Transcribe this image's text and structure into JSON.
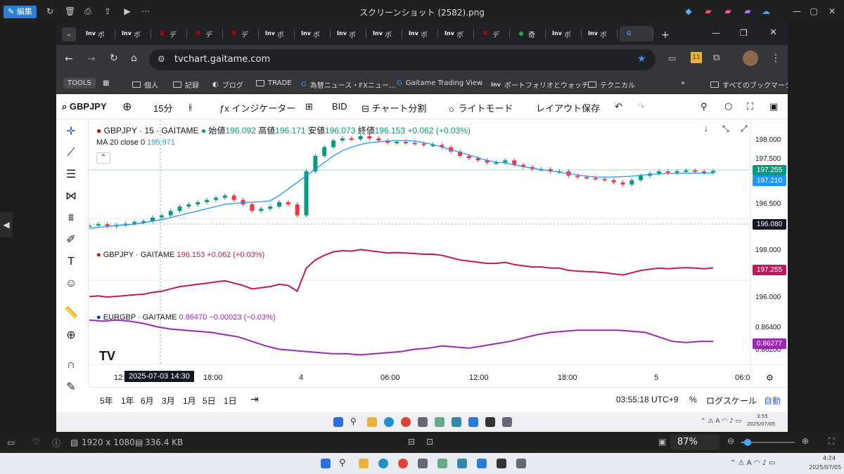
{
  "viewer": {
    "edit_label": "編集",
    "title": "スクリーンショット (2582).png",
    "dimensions": "1920 x 1080",
    "size": "336.4 KB",
    "zoom": "87%",
    "zoom_fraction": 0.12
  },
  "browser": {
    "url": "tvchart.gaitame.com",
    "tabs": [
      {
        "icon": "Inv",
        "label": "ボ",
        "color": "#ffffff"
      },
      {
        "icon": "Inv",
        "label": "ボ",
        "color": "#ffffff"
      },
      {
        "icon": "R",
        "label": "デ",
        "color": "#cc0000"
      },
      {
        "icon": "R",
        "label": "デ",
        "color": "#cc0000"
      },
      {
        "icon": "R",
        "label": "デ",
        "color": "#cc0000"
      },
      {
        "icon": "Inv",
        "label": "ボ",
        "color": "#ffffff"
      },
      {
        "icon": "Inv",
        "label": "ボ",
        "color": "#ffffff"
      },
      {
        "icon": "Inv",
        "label": "ボ",
        "color": "#ffffff"
      },
      {
        "icon": "Inv",
        "label": "ボ",
        "color": "#ffffff"
      },
      {
        "icon": "Inv",
        "label": "ボ",
        "color": "#ffffff"
      },
      {
        "icon": "Inv",
        "label": "ボ",
        "color": "#ffffff"
      },
      {
        "icon": "R",
        "label": "デ",
        "color": "#cc0000"
      },
      {
        "icon": "●",
        "label": "奇",
        "color": "#22aa44"
      },
      {
        "icon": "Inv",
        "label": "ボ",
        "color": "#ffffff"
      },
      {
        "icon": "Inv",
        "label": "ボ",
        "color": "#ffffff"
      },
      {
        "icon": "G",
        "label": "",
        "color": "#4a8af4"
      }
    ],
    "bookmarks": [
      "TOOLS",
      "個人",
      "記録",
      "ブログ",
      "TRADE",
      "為替ニュース・FXニュー…",
      "Gaitame Trading View",
      "ポートフォリオとウォッチ…",
      "テクニカル",
      "すべてのブックマーク"
    ]
  },
  "tv": {
    "toolbar": {
      "symbol": "GBPJPY",
      "interval": "15分",
      "indicators": "インジケーター",
      "bid": "BID",
      "split": "チャート分割",
      "theme": "ライトモード",
      "save": "レイアウト保存"
    },
    "main": {
      "title": "GBPJPY · 15 · GAITAME",
      "open_label": "始値",
      "open": "196.092",
      "high_label": "高値",
      "high": "196.171",
      "low_label": "安値",
      "low": "196.073",
      "close_label": "終値",
      "close": "196.153",
      "change": "+0.062 (+0.03%)",
      "ma_label": "MA 20 close 0",
      "ma_value": "195.971"
    },
    "pane2": {
      "title": "GBPJPY · GAITAME",
      "value": "196.153",
      "change": "+0.062 (+0.03%)"
    },
    "pane3": {
      "title": "EURGBP · GAITAME",
      "value": "0.86470",
      "change": "−0.00023 (−0.03%)"
    },
    "axis": {
      "p1": [
        "198.000",
        "197.500",
        "196.500"
      ],
      "p2": [
        "198.000",
        "196.000"
      ],
      "p3": [
        "0.86400",
        "0.86200"
      ]
    },
    "labels": {
      "last": "197.255",
      "ma": "197.210",
      "crosshair": "196.080",
      "pane2": "197.255",
      "pane3": "0.86277"
    },
    "time_axis": [
      "12:",
      "2025-07-03   14:30",
      "18:00",
      "4",
      "06:00",
      "12:00",
      "18:00",
      "5",
      "06:0"
    ],
    "bottom": {
      "ranges": [
        "5年",
        "1年",
        "6月",
        "3月",
        "1月",
        "5日",
        "1日"
      ],
      "clock": "03:55:18 UTC+9",
      "percent": "%",
      "log": "ログスケール",
      "auto": "自動"
    },
    "colors": {
      "up": "#089981",
      "down": "#f23645",
      "ma": "#2196f3",
      "pane2": "#c2185b",
      "pane3": "#9c27b0"
    }
  },
  "chart_data": [
    {
      "type": "line",
      "y": [
        196.02,
        196.05,
        196.0,
        196.03,
        196.06,
        196.1,
        196.12,
        196.2,
        196.25,
        196.35,
        196.45,
        196.5,
        196.55,
        196.6,
        196.65,
        196.7,
        196.6,
        196.5,
        196.35,
        196.4,
        196.45,
        196.55,
        196.5,
        196.25,
        197.25,
        197.6,
        197.8,
        197.95,
        198.0,
        197.98,
        198.05,
        198.0,
        197.95,
        197.9,
        197.92,
        197.9,
        197.88,
        197.85,
        197.85,
        197.8,
        197.7,
        197.6,
        197.55,
        197.5,
        197.45,
        197.45,
        197.5,
        197.4,
        197.35,
        197.3,
        197.3,
        197.25,
        197.25,
        197.15,
        197.12,
        197.1,
        197.08,
        197.05,
        197.0,
        196.95,
        197.05,
        197.15,
        197.2,
        197.25,
        197.22,
        197.25,
        197.27,
        197.25,
        197.22,
        197.26
      ],
      "ma20": [
        195.95,
        195.98,
        196.0,
        196.02,
        196.03,
        196.05,
        196.08,
        196.12,
        196.15,
        196.2,
        196.25,
        196.3,
        196.35,
        196.4,
        196.45,
        196.5,
        196.52,
        196.54,
        196.55,
        196.56,
        196.58,
        196.7,
        196.85,
        197.0,
        197.15,
        197.3,
        197.45,
        197.6,
        197.72,
        197.8,
        197.86,
        197.9,
        197.92,
        197.94,
        197.95,
        197.95,
        197.94,
        197.9,
        197.86,
        197.8,
        197.74,
        197.68,
        197.62,
        197.56,
        197.5,
        197.46,
        197.44,
        197.4,
        197.36,
        197.32,
        197.29,
        197.26,
        197.23,
        197.2,
        197.17,
        197.14,
        197.12,
        197.12,
        197.12,
        197.13,
        197.14,
        197.16,
        197.18,
        197.19,
        197.2,
        197.2,
        197.21,
        197.21,
        197.21,
        197.21
      ],
      "ylim": [
        195.9,
        198.2
      ]
    },
    {
      "type": "line",
      "name": "EURGBP · GAITAME",
      "y": [
        0.8647,
        0.8646,
        0.8647,
        0.8646,
        0.8644,
        0.8641,
        0.8639,
        0.8638,
        0.8637,
        0.8636,
        0.8634,
        0.8632,
        0.8628,
        0.8624,
        0.8621,
        0.862,
        0.8619,
        0.8618,
        0.8617,
        0.8617,
        0.8616,
        0.8617,
        0.8618,
        0.8619,
        0.8621,
        0.8622,
        0.8624,
        0.8623,
        0.8622,
        0.8624,
        0.8626,
        0.8628,
        0.8631,
        0.8634,
        0.8636,
        0.8637,
        0.8638,
        0.8638,
        0.8638,
        0.8638,
        0.8637,
        0.8636,
        0.8632,
        0.8628,
        0.8627,
        0.8628,
        0.8628
      ],
      "ylim": [
        0.8612,
        0.8652
      ]
    }
  ],
  "inner_taskbar": {
    "time": "3:55",
    "date": "2025/07/05"
  },
  "outer_taskbar": {
    "time": "4:24",
    "date": "2025/07/05"
  }
}
